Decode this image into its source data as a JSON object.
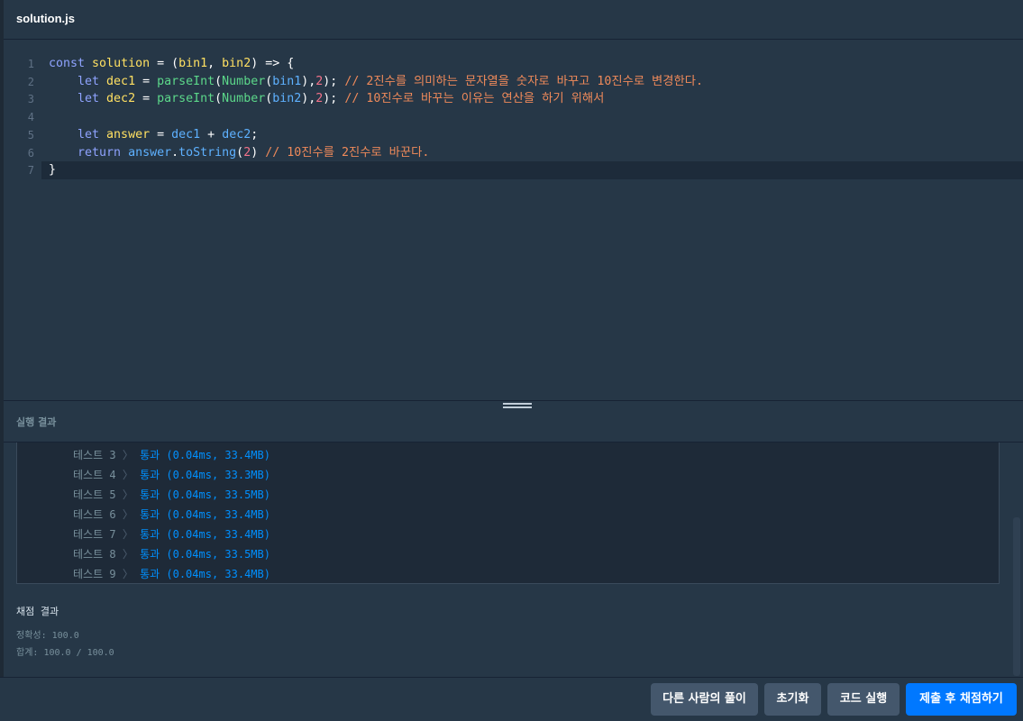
{
  "header": {
    "file_name": "solution.js"
  },
  "editor": {
    "lines": [
      {
        "num": "1",
        "tokens": [
          {
            "t": "const ",
            "c": "kw"
          },
          {
            "t": "solution",
            "c": "dv"
          },
          {
            "t": " = (",
            "c": "pn"
          },
          {
            "t": "bin1",
            "c": "dv"
          },
          {
            "t": ", ",
            "c": "pn"
          },
          {
            "t": "bin2",
            "c": "dv"
          },
          {
            "t": ") => {",
            "c": "pn"
          }
        ]
      },
      {
        "num": "2",
        "tokens": [
          {
            "t": "    let ",
            "c": "kw"
          },
          {
            "t": "dec1",
            "c": "dv"
          },
          {
            "t": " = ",
            "c": "pn"
          },
          {
            "t": "parseInt",
            "c": "fn"
          },
          {
            "t": "(",
            "c": "pn"
          },
          {
            "t": "Number",
            "c": "fn"
          },
          {
            "t": "(",
            "c": "pn"
          },
          {
            "t": "bin1",
            "c": "bi"
          },
          {
            "t": "),",
            "c": "pn"
          },
          {
            "t": "2",
            "c": "nm"
          },
          {
            "t": "); ",
            "c": "pn"
          },
          {
            "t": "// 2진수를 의미하는 문자열을 숫자로 바꾸고 10진수로 변경한다.",
            "c": "cm"
          }
        ]
      },
      {
        "num": "3",
        "tokens": [
          {
            "t": "    let ",
            "c": "kw"
          },
          {
            "t": "dec2",
            "c": "dv"
          },
          {
            "t": " = ",
            "c": "pn"
          },
          {
            "t": "parseInt",
            "c": "fn"
          },
          {
            "t": "(",
            "c": "pn"
          },
          {
            "t": "Number",
            "c": "fn"
          },
          {
            "t": "(",
            "c": "pn"
          },
          {
            "t": "bin2",
            "c": "bi"
          },
          {
            "t": "),",
            "c": "pn"
          },
          {
            "t": "2",
            "c": "nm"
          },
          {
            "t": "); ",
            "c": "pn"
          },
          {
            "t": "// 10진수로 바꾸는 이유는 연산을 하기 위해서",
            "c": "cm"
          }
        ]
      },
      {
        "num": "4",
        "tokens": []
      },
      {
        "num": "5",
        "tokens": [
          {
            "t": "    let ",
            "c": "kw"
          },
          {
            "t": "answer",
            "c": "dv"
          },
          {
            "t": " = ",
            "c": "pn"
          },
          {
            "t": "dec1",
            "c": "bi"
          },
          {
            "t": " + ",
            "c": "pn"
          },
          {
            "t": "dec2",
            "c": "bi"
          },
          {
            "t": ";",
            "c": "pn"
          }
        ]
      },
      {
        "num": "6",
        "tokens": [
          {
            "t": "    return ",
            "c": "kw"
          },
          {
            "t": "answer",
            "c": "bi"
          },
          {
            "t": ".",
            "c": "pn"
          },
          {
            "t": "toString",
            "c": "bi"
          },
          {
            "t": "(",
            "c": "pn"
          },
          {
            "t": "2",
            "c": "nm"
          },
          {
            "t": ") ",
            "c": "pn"
          },
          {
            "t": "// 10진수를 2진수로 바꾼다.",
            "c": "cm"
          }
        ]
      },
      {
        "num": "7",
        "tokens": [
          {
            "t": "}",
            "c": "pn"
          }
        ]
      }
    ]
  },
  "results": {
    "title": "실행 결과",
    "tests": [
      {
        "label": "테스트 3",
        "sep": "〉",
        "result": "통과 (0.04ms, 33.4MB)"
      },
      {
        "label": "테스트 4",
        "sep": "〉",
        "result": "통과 (0.04ms, 33.3MB)"
      },
      {
        "label": "테스트 5",
        "sep": "〉",
        "result": "통과 (0.04ms, 33.5MB)"
      },
      {
        "label": "테스트 6",
        "sep": "〉",
        "result": "통과 (0.04ms, 33.4MB)"
      },
      {
        "label": "테스트 7",
        "sep": "〉",
        "result": "통과 (0.04ms, 33.4MB)"
      },
      {
        "label": "테스트 8",
        "sep": "〉",
        "result": "통과 (0.04ms, 33.5MB)"
      },
      {
        "label": "테스트 9",
        "sep": "〉",
        "result": "통과 (0.04ms, 33.4MB)"
      }
    ],
    "grading_title": "채점 결과",
    "accuracy": "정확성: 100.0",
    "total": "합계: 100.0 / 100.0"
  },
  "footer": {
    "others_solutions": "다른 사람의 풀이",
    "reset": "초기화",
    "run_code": "코드 실행",
    "submit": "제출 후 채점하기"
  },
  "colors": {
    "background": "#263747",
    "primary_button": "#0078ff",
    "secondary_button": "#44576c",
    "pass_text": "#0090ff"
  }
}
